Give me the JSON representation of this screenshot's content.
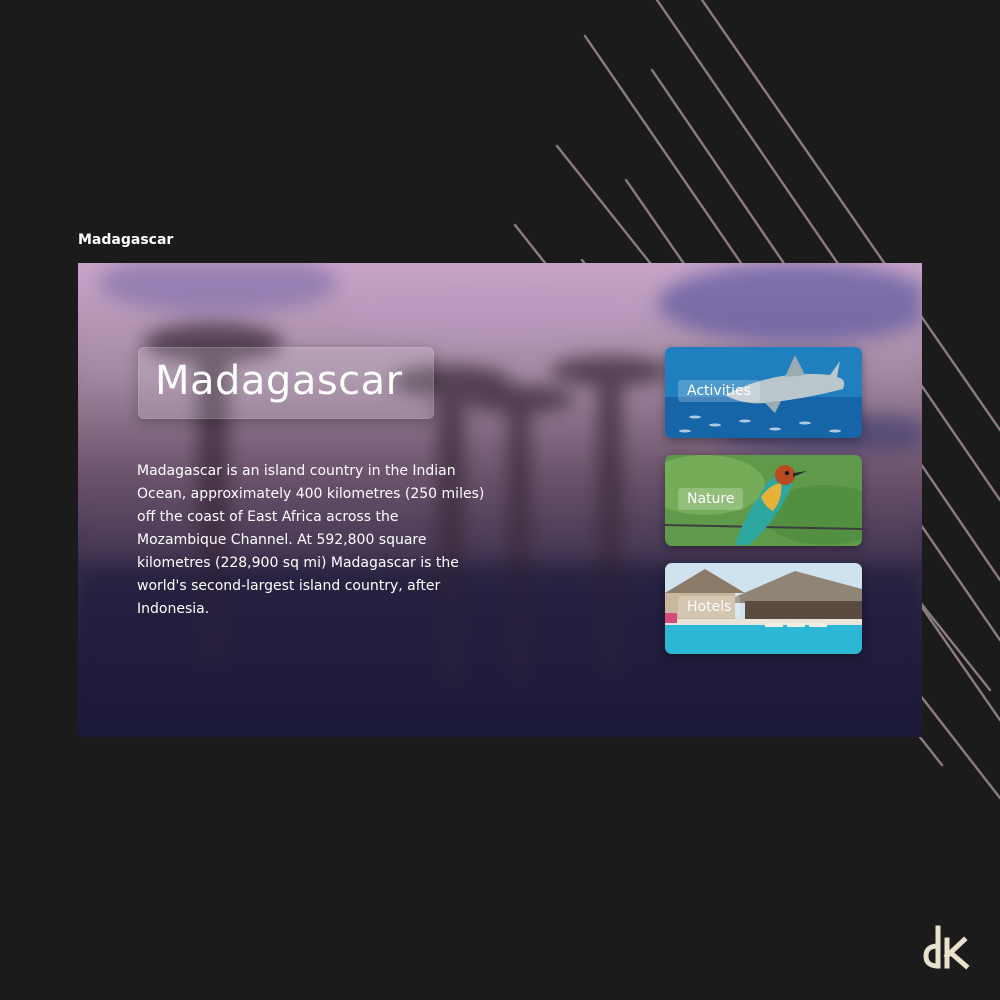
{
  "frame": {
    "label": "Madagascar"
  },
  "hero": {
    "title": "Madagascar",
    "description": "Madagascar is an island country in the Indian Ocean, approximately 400 kilometres (250 miles) off the coast of East Africa across the Mozambique Channel. At 592,800 square kilometres (228,900 sq mi) Madagascar is the world's second-largest island country, after Indonesia."
  },
  "categories": [
    {
      "label": "Activities",
      "icon": "shark-image"
    },
    {
      "label": "Nature",
      "icon": "bird-image"
    },
    {
      "label": "Hotels",
      "icon": "pool-image"
    }
  ],
  "colors": {
    "page_background": "#1c1b1c",
    "decorative_lines": "#8c7b80",
    "logo": "#e8e2cc"
  }
}
